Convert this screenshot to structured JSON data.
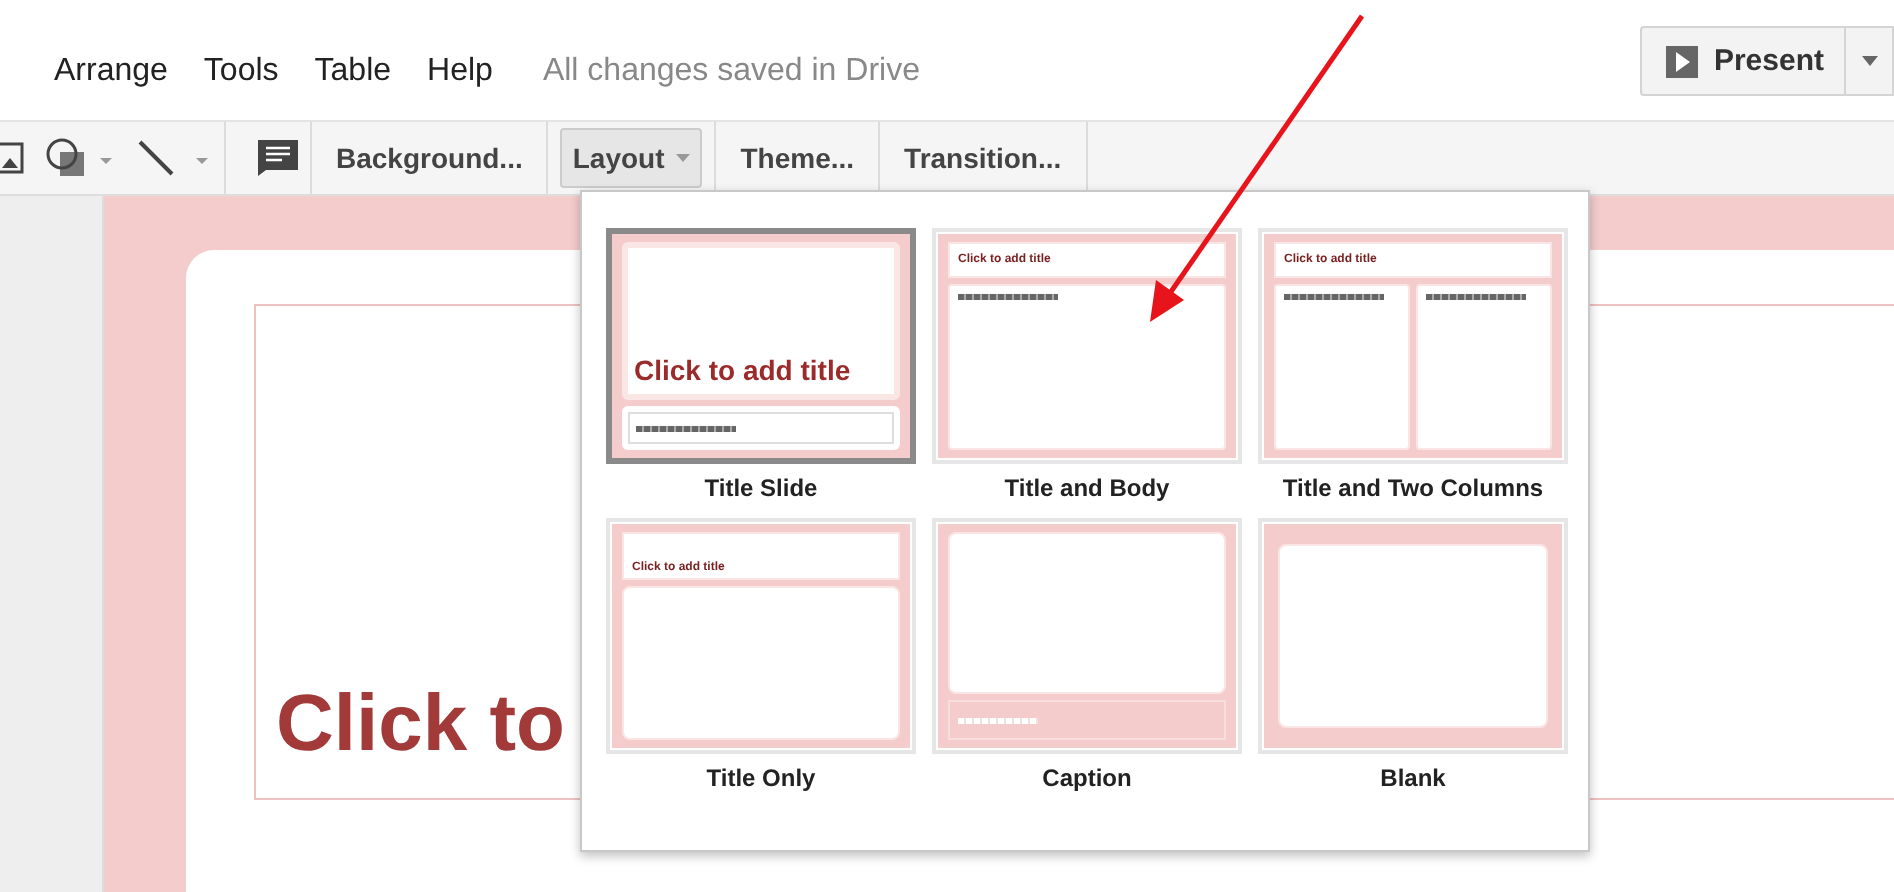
{
  "menu_bar": {
    "items": [
      "Arrange",
      "Tools",
      "Table",
      "Help"
    ],
    "save_status": "All changes saved in Drive"
  },
  "present_button": {
    "label": "Present"
  },
  "toolbar": {
    "items": [
      {
        "kind": "image"
      },
      {
        "kind": "shape"
      },
      {
        "kind": "line"
      },
      {
        "kind": "comment"
      },
      {
        "kind": "text",
        "label": "Background...",
        "selected": false
      },
      {
        "kind": "dropdown",
        "label": "Layout",
        "selected": true
      },
      {
        "kind": "text",
        "label": "Theme...",
        "selected": false
      },
      {
        "kind": "text",
        "label": "Transition...",
        "selected": false
      }
    ]
  },
  "slide": {
    "title_placeholder": "Click to"
  },
  "layout_menu": {
    "layouts": [
      {
        "kind": "title_slide",
        "name": "Title Slide",
        "selected": true,
        "thumbnail_title": "Click to add title"
      },
      {
        "kind": "title_body",
        "name": "Title and Body",
        "selected": false,
        "thumbnail_title": "Click to add title"
      },
      {
        "kind": "two_columns",
        "name": "Title and Two Columns",
        "selected": false,
        "thumbnail_title": "Click to add title"
      },
      {
        "kind": "title_only",
        "name": "Title Only",
        "selected": false,
        "thumbnail_title": "Click to add title"
      },
      {
        "kind": "caption",
        "name": "Caption",
        "selected": false
      },
      {
        "kind": "blank",
        "name": "Blank",
        "selected": false
      }
    ]
  }
}
